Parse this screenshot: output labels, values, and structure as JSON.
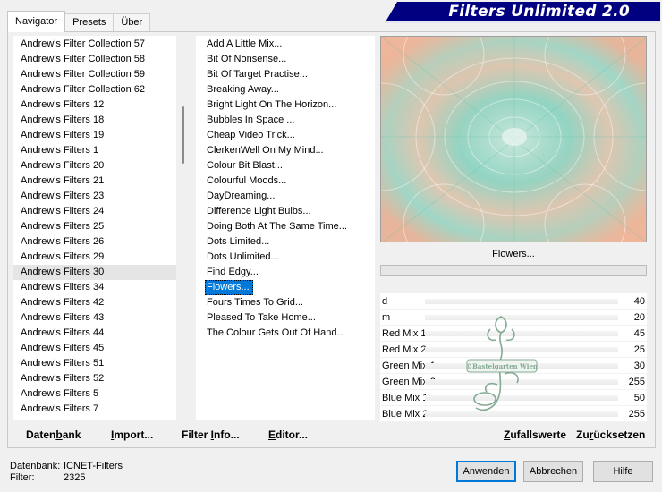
{
  "tabs": [
    {
      "label": "Navigator"
    },
    {
      "label": "Presets"
    },
    {
      "label": "Über"
    }
  ],
  "app_title": "Filters Unlimited 2.0",
  "categories": [
    "Andrew's Filter Collection 57",
    "Andrew's Filter Collection 58",
    "Andrew's Filter Collection 59",
    "Andrew's Filter Collection 62",
    "Andrew's Filters 12",
    "Andrew's Filters 18",
    "Andrew's Filters 19",
    "Andrew's Filters 1",
    "Andrew's Filters 20",
    "Andrew's Filters 21",
    "Andrew's Filters 23",
    "Andrew's Filters 24",
    "Andrew's Filters 25",
    "Andrew's Filters 26",
    "Andrew's Filters 29",
    "Andrew's Filters 30",
    "Andrew's Filters 34",
    "Andrew's Filters 42",
    "Andrew's Filters 43",
    "Andrew's Filters 44",
    "Andrew's Filters 45",
    "Andrew's Filters 51",
    "Andrew's Filters 52",
    "Andrew's Filters 5",
    "Andrew's Filters 7"
  ],
  "selected_category": "Andrew's Filters 30",
  "filters": [
    "Add A Little Mix...",
    "Bit Of Nonsense...",
    "Bit Of Target Practise...",
    "Breaking Away...",
    "Bright Light On The Horizon...",
    "Bubbles In Space ...",
    "Cheap Video Trick...",
    "ClerkenWell On My Mind...",
    "Colour Bit Blast...",
    "Colourful Moods...",
    "DayDreaming...",
    "Difference Light Bulbs...",
    "Doing Both At The Same Time...",
    "Dots Limited...",
    "Dots Unlimited...",
    "Find Edgy...",
    "Flowers...",
    "Fours Times To Grid...",
    "Pleased To Take Home...",
    "The Colour Gets Out Of Hand..."
  ],
  "selected_filter": "Flowers...",
  "preview_name": "Flowers...",
  "params": [
    {
      "name": "d",
      "value": "40"
    },
    {
      "name": "m",
      "value": "20"
    },
    {
      "name": "Red Mix 1",
      "value": "45"
    },
    {
      "name": "Red Mix 2",
      "value": "25"
    },
    {
      "name": "Green Mix 1",
      "value": "30"
    },
    {
      "name": "Green Mix 2",
      "value": "255"
    },
    {
      "name": "Blue Mix 1",
      "value": "50"
    },
    {
      "name": "Blue Mix 2",
      "value": "255"
    }
  ],
  "bottom_buttons": {
    "datenbank": {
      "pre": "Daten",
      "u": "b",
      "post": "ank"
    },
    "import": {
      "pre": "",
      "u": "I",
      "post": "mport..."
    },
    "filterinfo": {
      "pre": "Filter ",
      "u": "I",
      "post": "nfo..."
    },
    "editor": {
      "pre": "",
      "u": "E",
      "post": "ditor..."
    },
    "zufall": {
      "pre": "",
      "u": "Z",
      "post": "ufallswerte"
    },
    "zurueck": {
      "pre": "Zu",
      "u": "r",
      "post": "ücksetzen"
    }
  },
  "status": {
    "db_label": "Datenbank:",
    "db_value": "ICNET-Filters",
    "filter_label": "Filter:",
    "filter_value": "2325"
  },
  "dialog_buttons": {
    "apply": "Anwenden",
    "cancel": "Abbrechen",
    "help": "Hilfe"
  },
  "colors": {
    "title_bg": "#000080",
    "selection": "#0078d7",
    "preview_mint": "#a9dccb",
    "preview_peach": "#f2b79c"
  },
  "watermark_text": "©Bastelgarten Wien"
}
